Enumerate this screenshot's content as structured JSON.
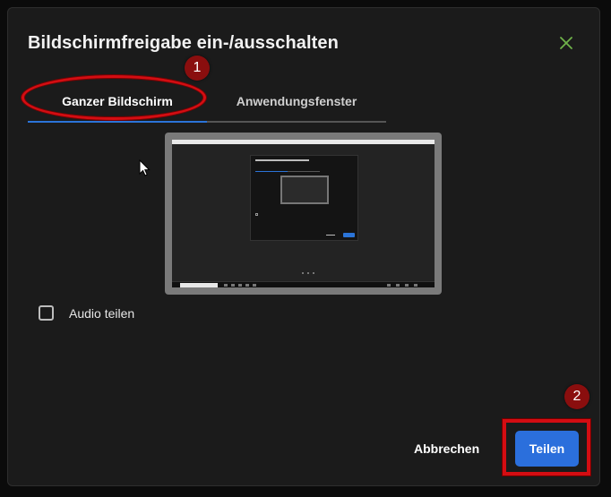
{
  "dialog": {
    "title": "Bildschirmfreigabe ein-/ausschalten",
    "close_icon": "close-x-icon"
  },
  "tabs": [
    {
      "label": "Ganzer Bildschirm",
      "active": true
    },
    {
      "label": "Anwendungsfenster",
      "active": false
    }
  ],
  "audio": {
    "label": "Audio teilen",
    "checked": false
  },
  "buttons": {
    "cancel_label": "Abbrechen",
    "share_label": "Teilen"
  },
  "annotations": {
    "step1": "1",
    "step2": "2"
  },
  "colors": {
    "accent": "#2b6fdc",
    "close_icon": "#6fb24a",
    "annotation_red": "#d40d12",
    "badge": "#8a0e0e"
  }
}
